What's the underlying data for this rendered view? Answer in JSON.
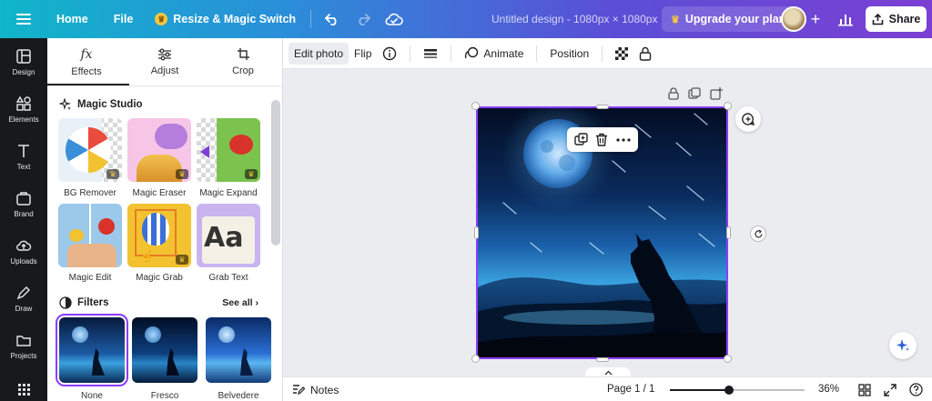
{
  "topbar": {
    "home": "Home",
    "file": "File",
    "magic_switch": "Resize & Magic Switch",
    "doc_title": "Untitled design - 1080px × 1080px",
    "upgrade": "Upgrade your plan",
    "share": "Share"
  },
  "rail": {
    "items": [
      "Design",
      "Elements",
      "Text",
      "Brand",
      "Uploads",
      "Draw",
      "Projects",
      "Apps"
    ]
  },
  "panel": {
    "tabs": [
      "Effects",
      "Adjust",
      "Crop"
    ],
    "magic_studio_title": "Magic Studio",
    "tools": [
      "BG Remover",
      "Magic Eraser",
      "Magic Expand",
      "Magic Edit",
      "Magic Grab",
      "Grab Text"
    ],
    "filters_title": "Filters",
    "see_all": "See all",
    "filters": [
      "None",
      "Fresco",
      "Belvedere"
    ]
  },
  "context_toolbar": {
    "edit_photo": "Edit photo",
    "flip": "Flip",
    "animate": "Animate",
    "position": "Position"
  },
  "bottombar": {
    "notes": "Notes",
    "page": "Page 1 / 1",
    "zoom": "36%",
    "zoom_fraction": 0.36
  },
  "colors": {
    "accent": "#8b3dff",
    "rail_bg": "#18191b",
    "canvas_bg": "#ebecf0"
  }
}
